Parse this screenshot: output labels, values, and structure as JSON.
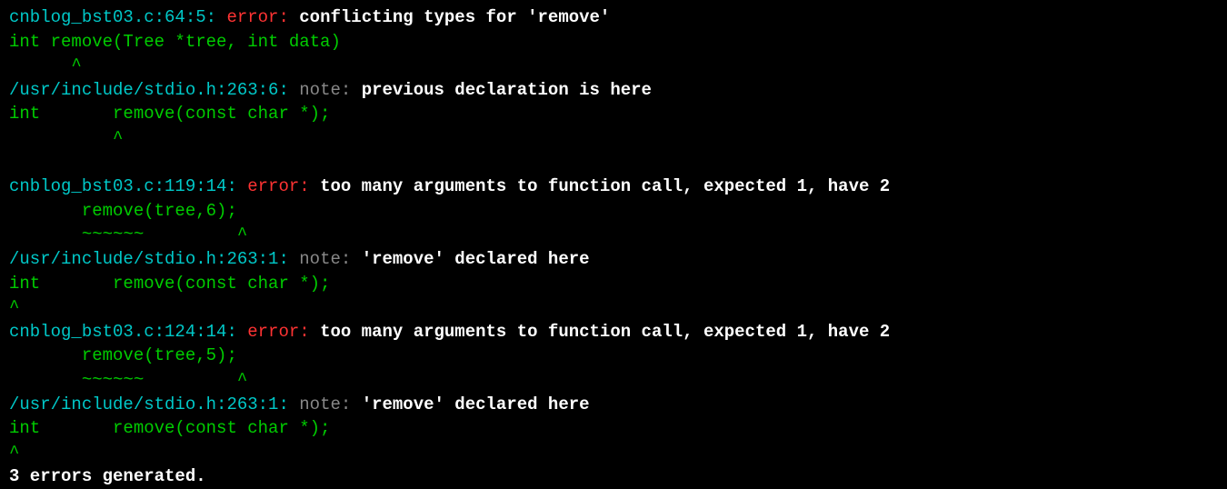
{
  "terminal": {
    "lines": [
      {
        "id": "line1",
        "segments": [
          {
            "text": "cnblog_bst03.c:64:5: ",
            "color": "cyan"
          },
          {
            "text": "error: ",
            "color": "red"
          },
          {
            "text": "conflicting types for 'remove'",
            "color": "bold-white"
          }
        ]
      },
      {
        "id": "line2",
        "segments": [
          {
            "text": "int remove(Tree *tree, int data)",
            "color": "green"
          }
        ]
      },
      {
        "id": "line3",
        "segments": [
          {
            "text": "      ^",
            "color": "green"
          }
        ]
      },
      {
        "id": "line4",
        "segments": [
          {
            "text": "/usr/include/stdio.h:263:6: ",
            "color": "cyan"
          },
          {
            "text": "note: ",
            "color": "gray"
          },
          {
            "text": "previous declaration is here",
            "color": "bold-white"
          }
        ]
      },
      {
        "id": "line5",
        "segments": [
          {
            "text": "int       remove(const char *);",
            "color": "green"
          }
        ]
      },
      {
        "id": "line6",
        "segments": [
          {
            "text": "          ^",
            "color": "green"
          }
        ]
      },
      {
        "id": "line7",
        "segments": []
      },
      {
        "id": "line8",
        "segments": [
          {
            "text": "cnblog_bst03.c:119:14: ",
            "color": "cyan"
          },
          {
            "text": "error: ",
            "color": "red"
          },
          {
            "text": "too many arguments to function call, expected 1, have 2",
            "color": "bold-white"
          }
        ]
      },
      {
        "id": "line9",
        "segments": [
          {
            "text": "       remove(tree,6);",
            "color": "green"
          }
        ]
      },
      {
        "id": "line10",
        "segments": [
          {
            "text": "       ~~~~~~         ^",
            "color": "green"
          }
        ]
      },
      {
        "id": "line11",
        "segments": [
          {
            "text": "/usr/include/stdio.h:263:1: ",
            "color": "cyan"
          },
          {
            "text": "note: ",
            "color": "gray"
          },
          {
            "text": "'remove' declared here",
            "color": "bold-white"
          }
        ]
      },
      {
        "id": "line12",
        "segments": [
          {
            "text": "int       remove(const char *);",
            "color": "green"
          }
        ]
      },
      {
        "id": "line13",
        "segments": [
          {
            "text": "^",
            "color": "green"
          }
        ]
      },
      {
        "id": "line14",
        "segments": [
          {
            "text": "cnblog_bst03.c:124:14: ",
            "color": "cyan"
          },
          {
            "text": "error: ",
            "color": "red"
          },
          {
            "text": "too many arguments to function call, expected 1, have 2",
            "color": "bold-white"
          }
        ]
      },
      {
        "id": "line15",
        "segments": [
          {
            "text": "       remove(tree,5);",
            "color": "green"
          }
        ]
      },
      {
        "id": "line16",
        "segments": [
          {
            "text": "       ~~~~~~         ^",
            "color": "green"
          }
        ]
      },
      {
        "id": "line17",
        "segments": [
          {
            "text": "/usr/include/stdio.h:263:1: ",
            "color": "cyan"
          },
          {
            "text": "note: ",
            "color": "gray"
          },
          {
            "text": "'remove' declared here",
            "color": "bold-white"
          }
        ]
      },
      {
        "id": "line18",
        "segments": [
          {
            "text": "int       remove(const char *);",
            "color": "green"
          }
        ]
      },
      {
        "id": "line19",
        "segments": [
          {
            "text": "^",
            "color": "green"
          }
        ]
      },
      {
        "id": "line20",
        "segments": [
          {
            "text": "3 errors generated.",
            "color": "bold-white"
          }
        ]
      }
    ]
  }
}
